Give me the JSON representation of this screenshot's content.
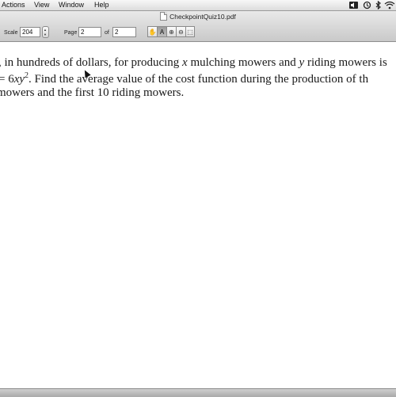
{
  "menubar": {
    "items": [
      "Actions",
      "View",
      "Window",
      "Help"
    ],
    "tray_icons": [
      "speaker-icon",
      "time-machine-icon",
      "bluetooth-icon",
      "wifi-icon"
    ]
  },
  "toolbar": {
    "document_title": "CheckpointQuiz10.pdf",
    "scale_label": "Scale",
    "scale_value": "204",
    "page_label": "Page",
    "page_value": "2",
    "of_label": "of",
    "page_total": "2",
    "tools": [
      "hand-tool",
      "text-select-tool",
      "zoom-in-tool",
      "zoom-out-tool",
      "select-area-tool"
    ],
    "tool_glyphs": [
      "✋",
      "A",
      "⊕",
      "⊖",
      "⬚"
    ],
    "active_tool": "text-select-tool"
  },
  "document": {
    "line1_a": ", in hundreds of dollars, for producing ",
    "line1_x": "x",
    "line1_b": " mulching mowers and ",
    "line1_y": "y",
    "line1_c": " riding mowers is",
    "line2_a": "= 6",
    "line2_xy": "xy",
    "line2_exp": "2",
    "line2_b": ".  Find the average value of the cost function during the production of th",
    "line3": " mowers and the first 10 riding mowers."
  },
  "colors": {
    "menubar": "#e6e6e6",
    "toolbar": "#d4d4d4",
    "page": "#ffffff",
    "text": "#1a1a1a"
  }
}
